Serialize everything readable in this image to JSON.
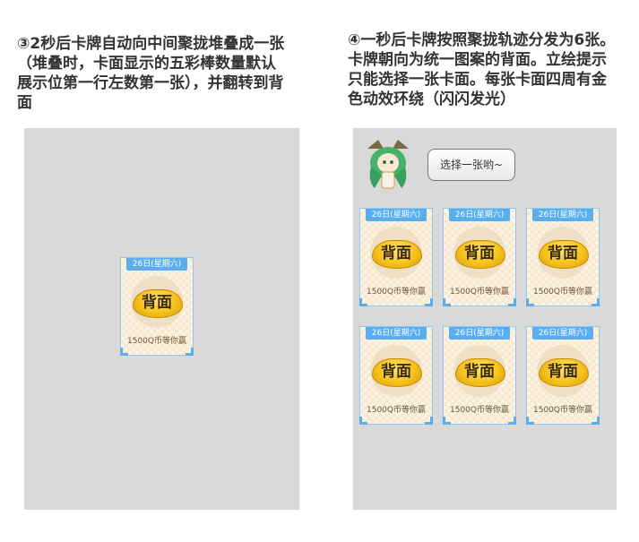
{
  "captions": {
    "left": "③2秒后卡牌自动向中间聚拢堆叠成一张（堆叠时，卡面显示的五彩棒数量默认展示位第一行左数第一张），并翻转到背面",
    "right": "④一秒后卡牌按照聚拢轨迹分发为6张。卡牌朝向为统一图案的背面。立绘提示只能选择一张卡面。每张卡面四周有金色动效环绕（闪闪发光）"
  },
  "bubble": "选择一张哟~",
  "card": {
    "date": "26日(星期六)",
    "title": "背面",
    "prize": "1500Q币等你赢"
  },
  "colors": {
    "panel_bg": "#d9d9d9",
    "card_header": "#5aaef0",
    "card_bg": "#fdf3e3",
    "emblem_gold": "#f5c21b"
  }
}
